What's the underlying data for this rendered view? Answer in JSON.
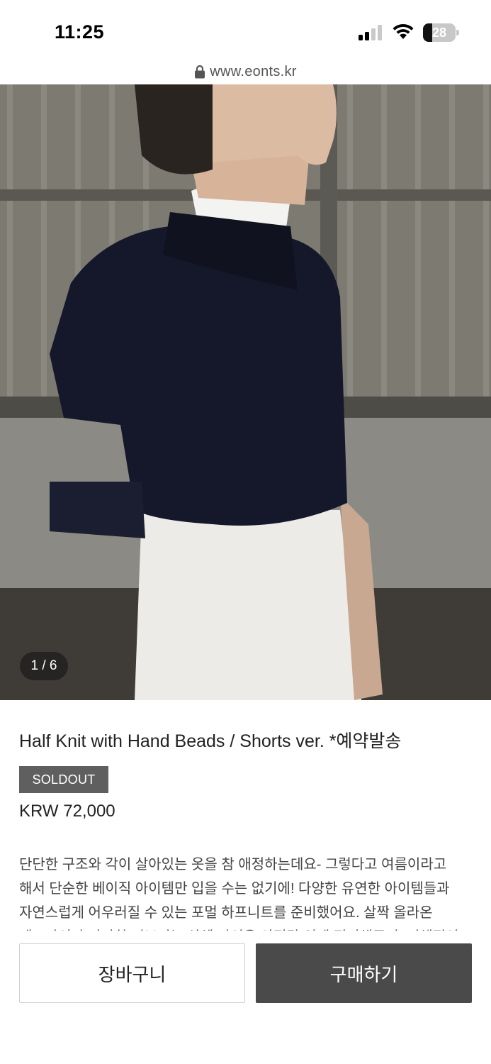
{
  "status_bar": {
    "time": "11:25",
    "battery_level": "28",
    "battery_fraction": 0.28,
    "icons": [
      "signal-icon",
      "wifi-icon",
      "battery-icon"
    ]
  },
  "browser": {
    "url": "www.eonts.kr",
    "lock_icon": "lock-icon"
  },
  "product": {
    "image_counter": "1 / 6",
    "title": "Half Knit with Hand Beads / Shorts ver. *예약발송",
    "badge": "SOLDOUT",
    "price": "KRW 72,000",
    "description": "단단한 구조와 각이 살아있는 옷을 참 애정하는데요- 그렇다고 여름이라고 해서 단순한 베이직 아이템만 입을 수는 없기에! 다양한 유연한 아이템들과 자연스럽게 어우러질 수 있는 포멀 하프니트를 준비했어요. 살짝 올라온 네크라인과 탄탄한 시보리는 상체 라인을 안정감 있게 정리해주며, 전체적인 인상을 더"
  },
  "actions": {
    "cart_label": "장바구니",
    "buy_label": "구매하기"
  },
  "colors": {
    "badge_bg": "#5f5f5f",
    "buy_bg": "#4a4a4a",
    "knit": "#14182a"
  }
}
